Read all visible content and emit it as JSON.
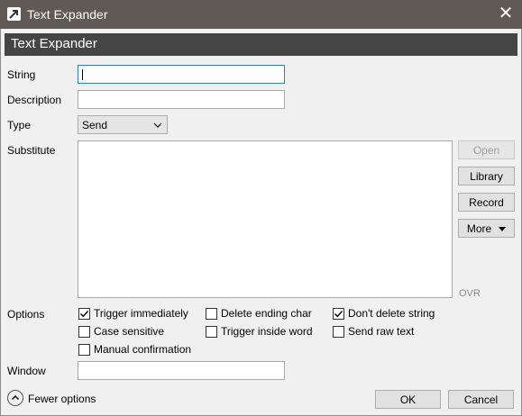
{
  "window": {
    "title": "Text Expander",
    "close_glyph": "✕"
  },
  "header": {
    "title": "Text Expander"
  },
  "fields": {
    "string_label": "String",
    "string_value": "",
    "description_label": "Description",
    "description_value": "",
    "type_label": "Type",
    "type_value": "Send",
    "substitute_label": "Substitute",
    "substitute_value": "",
    "window_label": "Window",
    "window_value": ""
  },
  "side_buttons": {
    "open": "Open",
    "library": "Library",
    "record": "Record",
    "more": "More"
  },
  "ovr": "OVR",
  "options": {
    "label": "Options",
    "trigger_immediately": {
      "label": "Trigger immediately",
      "checked": true
    },
    "delete_ending_char": {
      "label": "Delete ending char",
      "checked": false
    },
    "dont_delete_string": {
      "label": "Don't delete string",
      "checked": true
    },
    "case_sensitive": {
      "label": "Case sensitive",
      "checked": false
    },
    "trigger_inside_word": {
      "label": "Trigger inside word",
      "checked": false
    },
    "send_raw_text": {
      "label": "Send raw text",
      "checked": false
    },
    "manual_confirmation": {
      "label": "Manual confirmation",
      "checked": false
    }
  },
  "footer": {
    "fewer_options": "Fewer options",
    "ok": "OK",
    "cancel": "Cancel"
  },
  "colors": {
    "titlebar": "#5f5a55",
    "header_band": "#454545",
    "focus": "#2a7fd4"
  }
}
